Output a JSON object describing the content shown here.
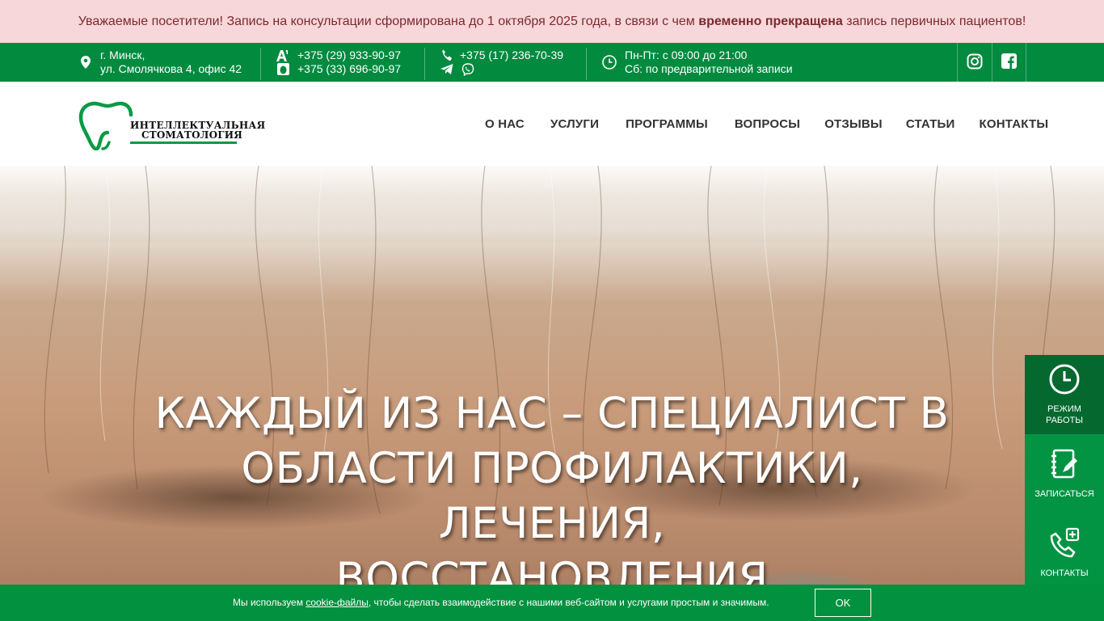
{
  "announcement": {
    "before": "Уважаемые посетители! Запись на консультации сформирована до 1 октября 2025 года, в связи с чем ",
    "bold": "временно прекращена",
    "after": " запись первичных пациентов!"
  },
  "topbar": {
    "address_line1": "г. Минск,",
    "address_line2": "ул. Смолячкова 4, офис 42",
    "mobile_a1": "+375 (29) 933-90-97",
    "mobile_mts": "+375 (33) 696-90-97",
    "landline": "+375 (17) 236-70-39",
    "hours_line1": "Пн-Пт: с 09:00 до 21:00",
    "hours_line2": "Сб: по предварительной записи"
  },
  "logo": {
    "line1": "ИНТЕЛЛЕКТУАЛЬНАЯ",
    "line2": "СТОМАТОЛОГИЯ"
  },
  "nav": [
    {
      "label": "О НАС"
    },
    {
      "label": "УСЛУГИ"
    },
    {
      "label": "ПРОГРАММЫ"
    },
    {
      "label": "ВОПРОСЫ"
    },
    {
      "label": "ОТЗЫВЫ"
    },
    {
      "label": "СТАТЬИ"
    },
    {
      "label": "КОНТАКТЫ"
    }
  ],
  "hero": {
    "title_line1": "КАЖДЫЙ ИЗ НАС – СПЕЦИАЛИСТ В",
    "title_line2": "ОБЛАСТИ ПРОФИЛАКТИКИ, ЛЕЧЕНИЯ,",
    "title_line3": "ВОССТАНОВЛЕНИЯ"
  },
  "widgets": {
    "hours_line1": "РЕЖИМ",
    "hours_line2": "РАБОТЫ",
    "signup": "ЗАПИСАТЬСЯ",
    "contacts": "КОНТАКТЫ"
  },
  "cookie": {
    "before": "Мы используем ",
    "link": "cookie-файлы",
    "after": ", чтобы сделать взаимодействие с нашими веб-сайтом и услугами простым и значимым.",
    "ok": "OK"
  },
  "icons": {
    "location": "map-pin-icon",
    "a1": "a1-operator-icon",
    "mts": "mts-operator-icon",
    "phone": "phone-icon",
    "telegram": "telegram-icon",
    "viber": "viber-icon",
    "clock": "clock-icon",
    "instagram": "instagram-icon",
    "facebook": "facebook-icon",
    "tooth": "tooth-logo-icon",
    "signup": "signup-form-icon",
    "contacts": "phone-plus-icon"
  },
  "colors": {
    "brand_green": "#028a3f",
    "dark_green": "#04682f",
    "alert_bg": "#f8d7da",
    "alert_text": "#7a2a2e"
  }
}
